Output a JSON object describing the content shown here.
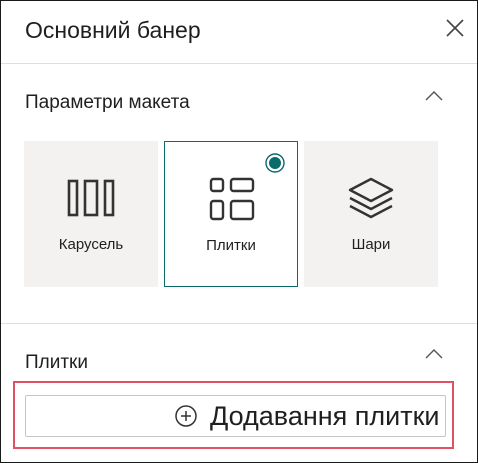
{
  "panel": {
    "title": "Основний банер",
    "close_icon": "close-icon"
  },
  "layout_section": {
    "title": "Параметри макета",
    "options": [
      {
        "label": "Карусель",
        "icon": "carousel-icon",
        "selected": false
      },
      {
        "label": "Плитки",
        "icon": "tiles-icon",
        "selected": true
      },
      {
        "label": "Шари",
        "icon": "layers-icon",
        "selected": false
      }
    ]
  },
  "tiles_section": {
    "title": "Плитки",
    "add_button_label": "Додавання плитки",
    "add_icon": "add-circle-icon"
  },
  "colors": {
    "accent": "#0b6a6a",
    "highlight": "#e05260",
    "tile_bg": "#f3f2f1"
  }
}
